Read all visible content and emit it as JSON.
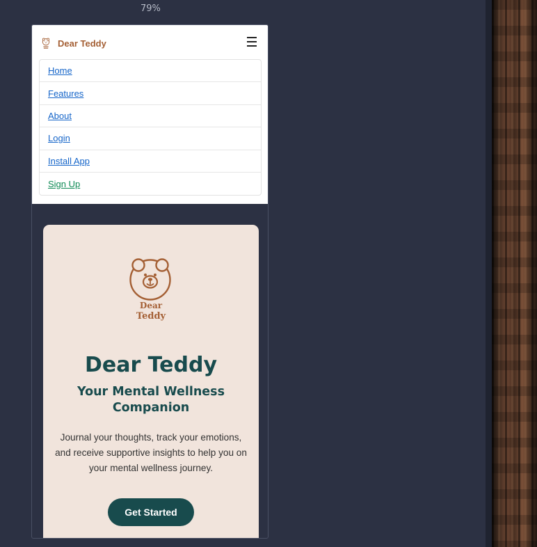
{
  "viewport": {
    "zoom": "79%"
  },
  "navbar": {
    "brand": "Dear Teddy",
    "menu_icon": "hamburger-icon",
    "items": [
      {
        "label": "Home"
      },
      {
        "label": "Features"
      },
      {
        "label": "About"
      },
      {
        "label": "Login"
      },
      {
        "label": "Install App"
      },
      {
        "label": "Sign Up"
      }
    ]
  },
  "hero": {
    "logo_line1": "Dear",
    "logo_line2": "Teddy",
    "title": "Dear Teddy",
    "subtitle": "Your Mental Wellness Companion",
    "description": "Journal your thoughts, track your emotions, and receive supportive insights to help you on your mental wellness journey.",
    "cta_label": "Get Started"
  },
  "colors": {
    "brand": "#a45f34",
    "primary": "#184b4d",
    "hero_bg": "#f1e4dc",
    "link": "#1565c9",
    "signup_link": "#0e8a55",
    "page_bg": "#2c3143"
  }
}
